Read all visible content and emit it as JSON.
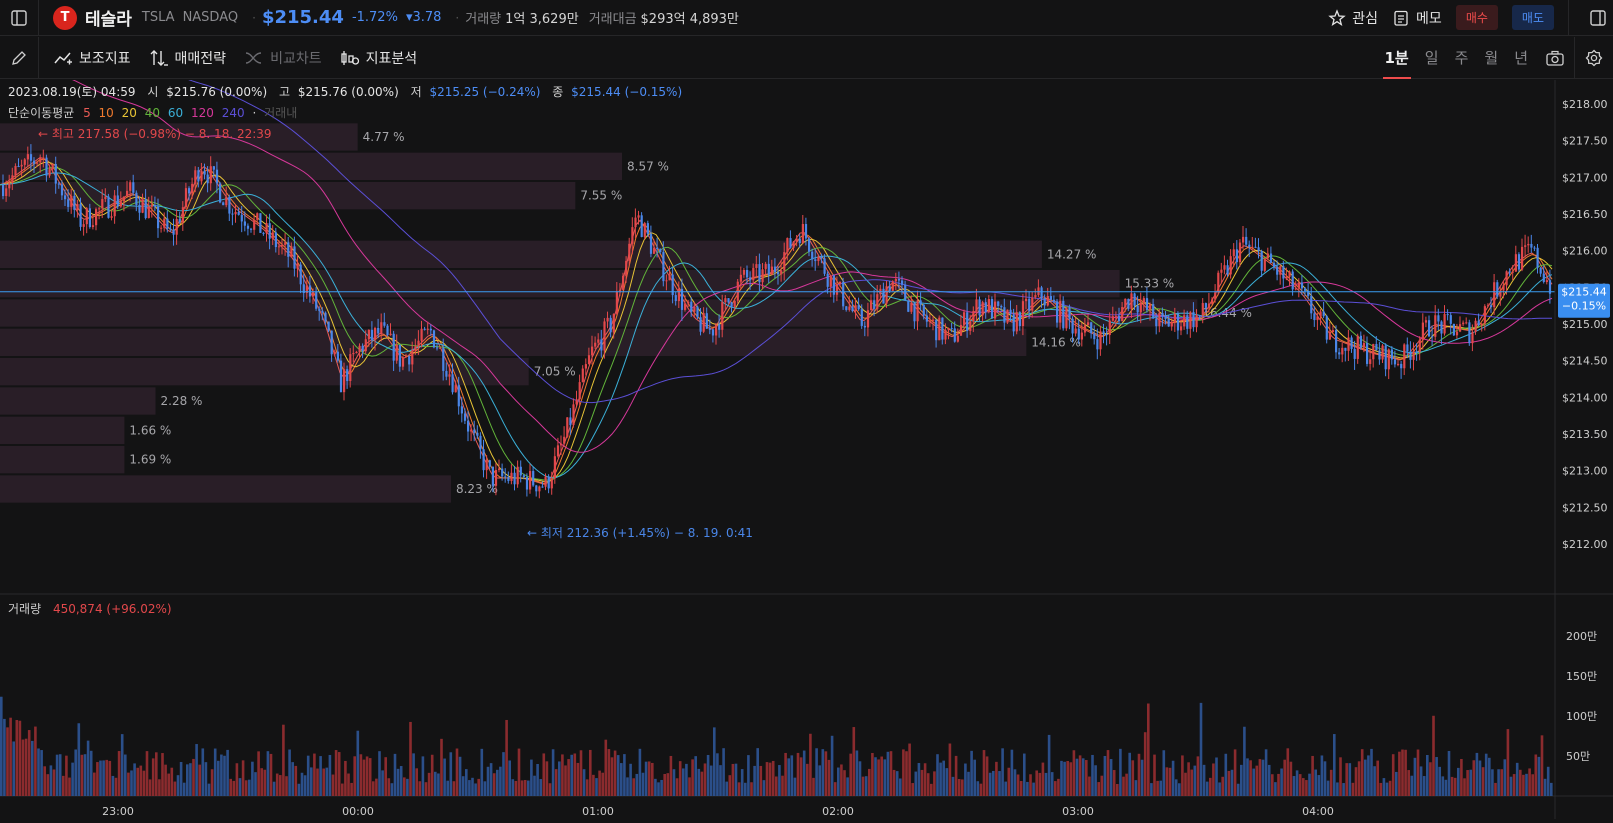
{
  "header": {
    "title": "테슬라",
    "logo_letter": "T",
    "ticker": "TSLA",
    "exchange": "NASDAQ",
    "price": "$215.44",
    "change_pct": "-1.72%",
    "change_abs": "▾3.78",
    "volume_label": "거래량",
    "volume_value": "1억 3,629만",
    "amount_label": "거래대금",
    "amount_value": "$293억 4,893만",
    "watch_label": "관심",
    "memo_label": "메모",
    "buy_label": "매수",
    "sell_label": "매도"
  },
  "toolbar": {
    "indicators": "보조지표",
    "strategy": "매매전략",
    "compare": "비교차트",
    "analysis": "지표분석",
    "periods": [
      "1분",
      "일",
      "주",
      "월",
      "년"
    ],
    "active_period": "1분"
  },
  "legend": {
    "date": "2023.08.19(토) 04:59",
    "open_label": "시",
    "open": "$215.76 (0.00%)",
    "high_label": "고",
    "high": "$215.76 (0.00%)",
    "low_label": "저",
    "low": "$215.25 (−0.24%)",
    "close_label": "종",
    "close": "$215.44 (−0.15%)",
    "ma_label": "단순이동평균",
    "ma_periods": [
      "5",
      "10",
      "20",
      "40",
      "60",
      "120",
      "240"
    ],
    "ma_colors": [
      "#e85b55",
      "#f07a2e",
      "#e8c436",
      "#62b43a",
      "#3bb0d8",
      "#d6389a",
      "#5b4fd6"
    ],
    "ma_extra": "거래내",
    "max_note": "← 최고 217.58 (−0.98%) − 8. 18. 22:39",
    "min_note": "← 최저 212.36 (+1.45%) − 8. 19. 0:41"
  },
  "price_axis": {
    "ticks": [
      "$218.00",
      "$217.50",
      "$217.00",
      "$216.50",
      "$216.00",
      "$215.50",
      "$215.00",
      "$214.50",
      "$214.00",
      "$213.50",
      "$213.00",
      "$212.50",
      "$212.00"
    ],
    "current_price": "$215.44",
    "current_change": "−0.15%"
  },
  "volume": {
    "label": "거래량",
    "value": "450,874 (+96.02%)",
    "ticks": [
      "200만",
      "150만",
      "100만",
      "50만"
    ]
  },
  "time_axis": [
    "23:00",
    "00:00",
    "01:00",
    "02:00",
    "03:00",
    "04:00"
  ],
  "volume_profile": [
    {
      "price_top": 217.75,
      "price_bottom": 217.35,
      "width": 0.23,
      "label": "4.77 %"
    },
    {
      "price_top": 217.35,
      "price_bottom": 216.95,
      "width": 0.4,
      "label": "8.57 %"
    },
    {
      "price_top": 216.95,
      "price_bottom": 216.55,
      "width": 0.37,
      "label": "7.55 %"
    },
    {
      "price_top": 216.15,
      "price_bottom": 215.75,
      "width": 0.67,
      "label": "14.27 %"
    },
    {
      "price_top": 215.75,
      "price_bottom": 215.35,
      "width": 0.72,
      "label": "15.33 %"
    },
    {
      "price_top": 215.35,
      "price_bottom": 214.95,
      "width": 0.77,
      "label": "16.44 %"
    },
    {
      "price_top": 214.95,
      "price_bottom": 214.55,
      "width": 0.66,
      "label": "14.16 %"
    },
    {
      "price_top": 214.55,
      "price_bottom": 214.15,
      "width": 0.34,
      "label": "7.05 %"
    },
    {
      "price_top": 214.15,
      "price_bottom": 213.75,
      "width": 0.1,
      "label": "2.28 %"
    },
    {
      "price_top": 213.75,
      "price_bottom": 213.35,
      "width": 0.08,
      "label": "1.66 %"
    },
    {
      "price_top": 213.35,
      "price_bottom": 212.95,
      "width": 0.08,
      "label": "1.69 %"
    },
    {
      "price_top": 212.95,
      "price_bottom": 212.55,
      "width": 0.29,
      "label": "8.23 %"
    }
  ],
  "colors": {
    "up": "#e2484b",
    "down": "#4a86e8",
    "current_line": "#3a9cf2"
  }
}
